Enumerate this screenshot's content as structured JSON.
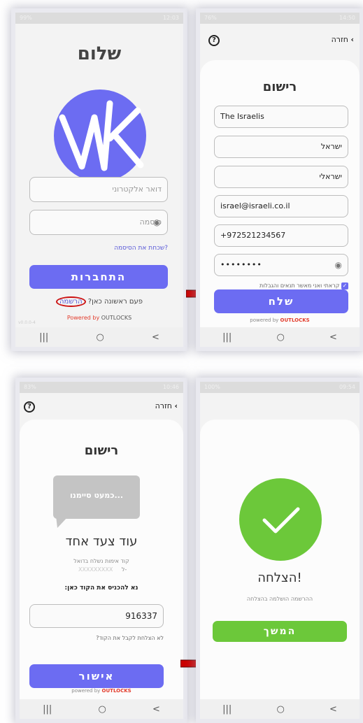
{
  "screen1": {
    "status": {
      "left": "99% ",
      "right": "12:03"
    },
    "title": "שלום",
    "email_placeholder": "דואר אלקטרוני",
    "password_placeholder": "סיסמה",
    "forgot": "שכחת את הסיסמה?",
    "login_button": "התחברות",
    "first_time": "פעם ראשונה כאן?",
    "register_link": "הרשמה",
    "powered_by": "Powered by",
    "brand": "OUTLOCKS",
    "version": "v0.0.0-4",
    "nav": [
      "|||",
      "○",
      "<"
    ]
  },
  "screen2": {
    "status": {
      "left": "76% ",
      "right": "14:50"
    },
    "back_label": "חזרה",
    "title": "רישום",
    "fields": [
      "The Israelis",
      "ישראל",
      "ישראלי",
      "israel@israeli.co.il",
      "+972521234567",
      "••••••••"
    ],
    "agree_text": "קראתי ואני מאשר תנאים והגבלות",
    "send_button": "שלח",
    "powered_by": "powered by",
    "brand": "OUTLOCKS",
    "nav": [
      "|||",
      "○",
      "<"
    ]
  },
  "screen3": {
    "status": {
      "left": "83% ",
      "right": "10:46"
    },
    "back_label": "חזרה",
    "title": "רישום",
    "bubble_text": "כמעט סיימנו...",
    "subtitle": "עוד צעד אחד",
    "sent_line": "קוד אימות נשלח בדואל",
    "to_label": "ל-",
    "masked_email": "XXXXXXXXX",
    "enter_code": "נא להכניס את הקוד כאן:",
    "code_value": "916337",
    "no_code": "לא הצלחת לקבל את הקוד?",
    "confirm_button": "אישור",
    "powered_by": "powered by",
    "brand": "OUTLOCKS",
    "nav": [
      "|||",
      "○",
      "<"
    ]
  },
  "screen4": {
    "status": {
      "left": "100% ",
      "right": "09:54"
    },
    "success_title": "הצלחה!",
    "success_sub": "ההרשמה הושלמה בהצלחה",
    "continue_button": "המשך",
    "nav": [
      "|||",
      "○",
      "<"
    ]
  },
  "colors": {
    "accent": "#6c6cf2",
    "success": "#6cc83a",
    "arrow": "#cc0000",
    "brand_red": "#e23b2b"
  }
}
